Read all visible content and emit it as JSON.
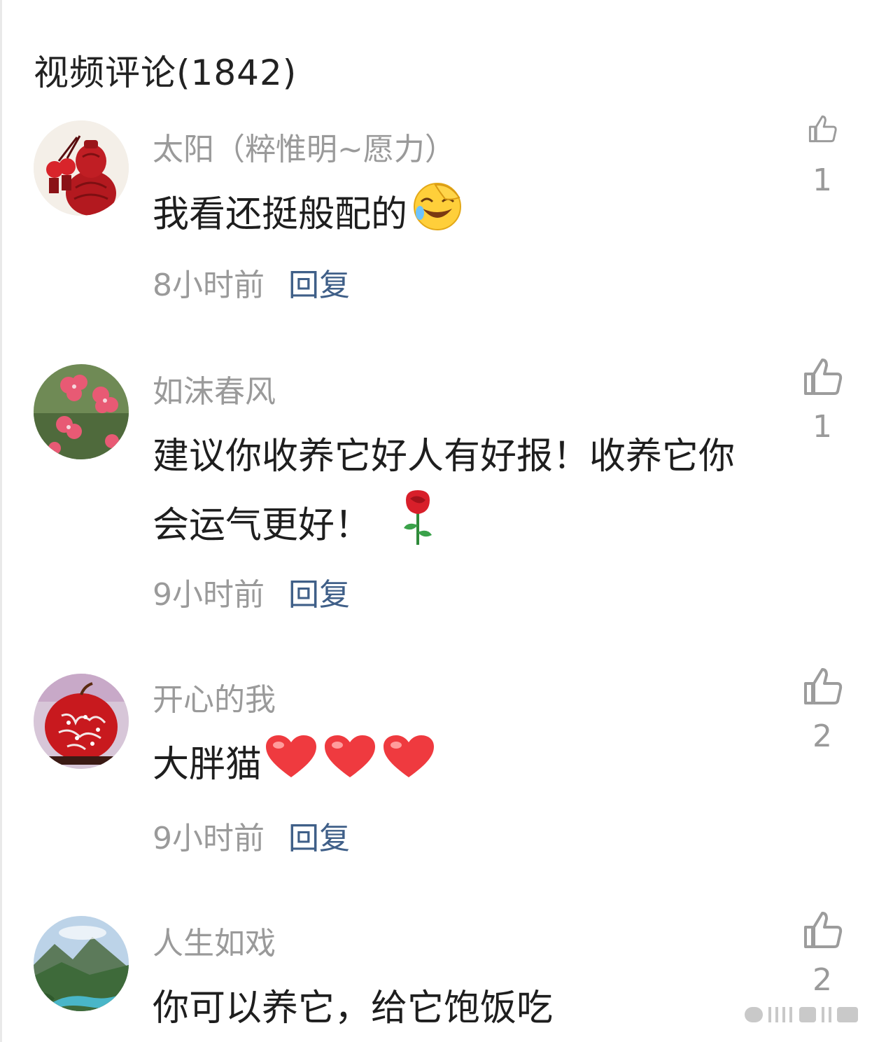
{
  "header": {
    "title": "视频评论(1842)"
  },
  "comments": [
    {
      "username": "太阳（粹惟明~愿力）",
      "content": "我看还挺般配的",
      "emoji": "laughing-crying-face-emoji",
      "time": "8小时前",
      "reply_label": "回复",
      "likes": "1"
    },
    {
      "username": "如沫春风",
      "content": "建议你收养它好人有好报！收养它你会运气更好！",
      "emoji": "rose-emoji",
      "time": "9小时前",
      "reply_label": "回复",
      "likes": "1"
    },
    {
      "username": "开心的我",
      "content": "大胖猫",
      "emoji": "red-heart-emoji",
      "time": "9小时前",
      "reply_label": "回复",
      "likes": "2"
    },
    {
      "username": "人生如戏",
      "content": "你可以养它，给它饱饭吃",
      "emoji": "",
      "time": "",
      "reply_label": "",
      "likes": "2"
    }
  ],
  "colors": {
    "reply": "#3f5f88",
    "secondary_text": "#9a9a9a",
    "primary_text": "#1e1e1e"
  }
}
